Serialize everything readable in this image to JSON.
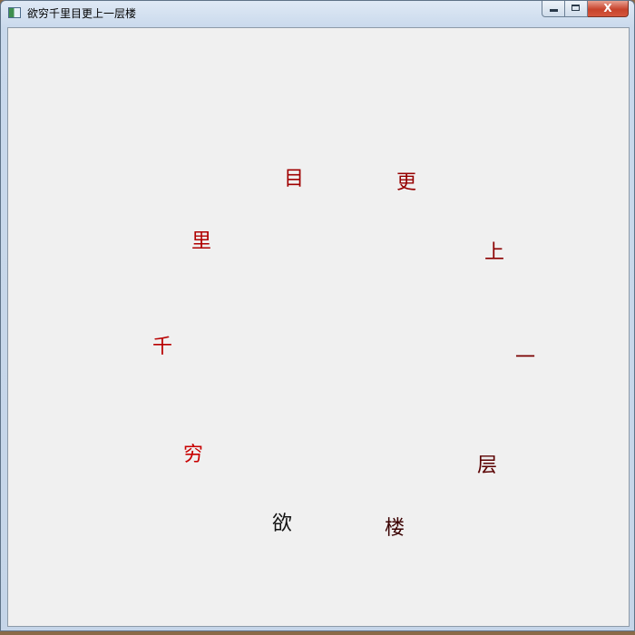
{
  "window": {
    "title": "欲穷千里目更上一层楼"
  },
  "caption_buttons": {
    "minimize_icon": "minimize-icon",
    "maximize_icon": "maximize-icon",
    "close_label": "X"
  },
  "poem": {
    "characters": [
      {
        "text": "欲",
        "color": "#111111"
      },
      {
        "text": "穷",
        "color": "#c80000"
      },
      {
        "text": "千",
        "color": "#b80000"
      },
      {
        "text": "里",
        "color": "#b00000"
      },
      {
        "text": "目",
        "color": "#a00000"
      },
      {
        "text": "更",
        "color": "#960000"
      },
      {
        "text": "上",
        "color": "#8c0000"
      },
      {
        "text": "一",
        "color": "#7a0000"
      },
      {
        "text": "层",
        "color": "#5a0000"
      },
      {
        "text": "楼",
        "color": "#3a0000"
      }
    ]
  }
}
